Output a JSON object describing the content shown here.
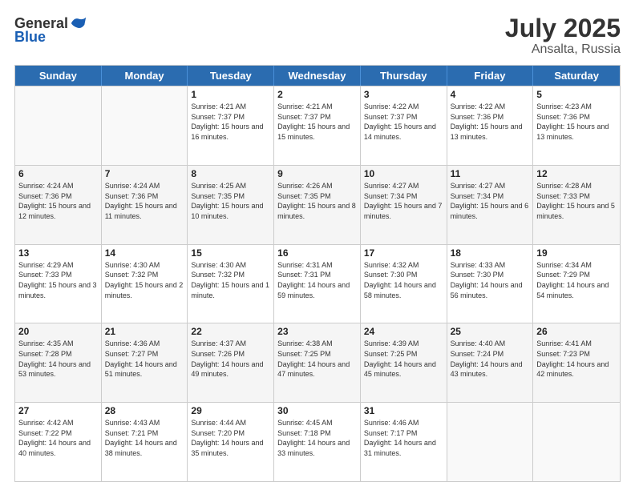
{
  "header": {
    "logo_general": "General",
    "logo_blue": "Blue",
    "main_title": "July 2025",
    "subtitle": "Ansalta, Russia"
  },
  "calendar": {
    "days_of_week": [
      "Sunday",
      "Monday",
      "Tuesday",
      "Wednesday",
      "Thursday",
      "Friday",
      "Saturday"
    ],
    "weeks": [
      [
        {
          "day": "",
          "info": ""
        },
        {
          "day": "",
          "info": ""
        },
        {
          "day": "1",
          "info": "Sunrise: 4:21 AM\nSunset: 7:37 PM\nDaylight: 15 hours and 16 minutes."
        },
        {
          "day": "2",
          "info": "Sunrise: 4:21 AM\nSunset: 7:37 PM\nDaylight: 15 hours and 15 minutes."
        },
        {
          "day": "3",
          "info": "Sunrise: 4:22 AM\nSunset: 7:37 PM\nDaylight: 15 hours and 14 minutes."
        },
        {
          "day": "4",
          "info": "Sunrise: 4:22 AM\nSunset: 7:36 PM\nDaylight: 15 hours and 13 minutes."
        },
        {
          "day": "5",
          "info": "Sunrise: 4:23 AM\nSunset: 7:36 PM\nDaylight: 15 hours and 13 minutes."
        }
      ],
      [
        {
          "day": "6",
          "info": "Sunrise: 4:24 AM\nSunset: 7:36 PM\nDaylight: 15 hours and 12 minutes."
        },
        {
          "day": "7",
          "info": "Sunrise: 4:24 AM\nSunset: 7:36 PM\nDaylight: 15 hours and 11 minutes."
        },
        {
          "day": "8",
          "info": "Sunrise: 4:25 AM\nSunset: 7:35 PM\nDaylight: 15 hours and 10 minutes."
        },
        {
          "day": "9",
          "info": "Sunrise: 4:26 AM\nSunset: 7:35 PM\nDaylight: 15 hours and 8 minutes."
        },
        {
          "day": "10",
          "info": "Sunrise: 4:27 AM\nSunset: 7:34 PM\nDaylight: 15 hours and 7 minutes."
        },
        {
          "day": "11",
          "info": "Sunrise: 4:27 AM\nSunset: 7:34 PM\nDaylight: 15 hours and 6 minutes."
        },
        {
          "day": "12",
          "info": "Sunrise: 4:28 AM\nSunset: 7:33 PM\nDaylight: 15 hours and 5 minutes."
        }
      ],
      [
        {
          "day": "13",
          "info": "Sunrise: 4:29 AM\nSunset: 7:33 PM\nDaylight: 15 hours and 3 minutes."
        },
        {
          "day": "14",
          "info": "Sunrise: 4:30 AM\nSunset: 7:32 PM\nDaylight: 15 hours and 2 minutes."
        },
        {
          "day": "15",
          "info": "Sunrise: 4:30 AM\nSunset: 7:32 PM\nDaylight: 15 hours and 1 minute."
        },
        {
          "day": "16",
          "info": "Sunrise: 4:31 AM\nSunset: 7:31 PM\nDaylight: 14 hours and 59 minutes."
        },
        {
          "day": "17",
          "info": "Sunrise: 4:32 AM\nSunset: 7:30 PM\nDaylight: 14 hours and 58 minutes."
        },
        {
          "day": "18",
          "info": "Sunrise: 4:33 AM\nSunset: 7:30 PM\nDaylight: 14 hours and 56 minutes."
        },
        {
          "day": "19",
          "info": "Sunrise: 4:34 AM\nSunset: 7:29 PM\nDaylight: 14 hours and 54 minutes."
        }
      ],
      [
        {
          "day": "20",
          "info": "Sunrise: 4:35 AM\nSunset: 7:28 PM\nDaylight: 14 hours and 53 minutes."
        },
        {
          "day": "21",
          "info": "Sunrise: 4:36 AM\nSunset: 7:27 PM\nDaylight: 14 hours and 51 minutes."
        },
        {
          "day": "22",
          "info": "Sunrise: 4:37 AM\nSunset: 7:26 PM\nDaylight: 14 hours and 49 minutes."
        },
        {
          "day": "23",
          "info": "Sunrise: 4:38 AM\nSunset: 7:25 PM\nDaylight: 14 hours and 47 minutes."
        },
        {
          "day": "24",
          "info": "Sunrise: 4:39 AM\nSunset: 7:25 PM\nDaylight: 14 hours and 45 minutes."
        },
        {
          "day": "25",
          "info": "Sunrise: 4:40 AM\nSunset: 7:24 PM\nDaylight: 14 hours and 43 minutes."
        },
        {
          "day": "26",
          "info": "Sunrise: 4:41 AM\nSunset: 7:23 PM\nDaylight: 14 hours and 42 minutes."
        }
      ],
      [
        {
          "day": "27",
          "info": "Sunrise: 4:42 AM\nSunset: 7:22 PM\nDaylight: 14 hours and 40 minutes."
        },
        {
          "day": "28",
          "info": "Sunrise: 4:43 AM\nSunset: 7:21 PM\nDaylight: 14 hours and 38 minutes."
        },
        {
          "day": "29",
          "info": "Sunrise: 4:44 AM\nSunset: 7:20 PM\nDaylight: 14 hours and 35 minutes."
        },
        {
          "day": "30",
          "info": "Sunrise: 4:45 AM\nSunset: 7:18 PM\nDaylight: 14 hours and 33 minutes."
        },
        {
          "day": "31",
          "info": "Sunrise: 4:46 AM\nSunset: 7:17 PM\nDaylight: 14 hours and 31 minutes."
        },
        {
          "day": "",
          "info": ""
        },
        {
          "day": "",
          "info": ""
        }
      ]
    ]
  }
}
